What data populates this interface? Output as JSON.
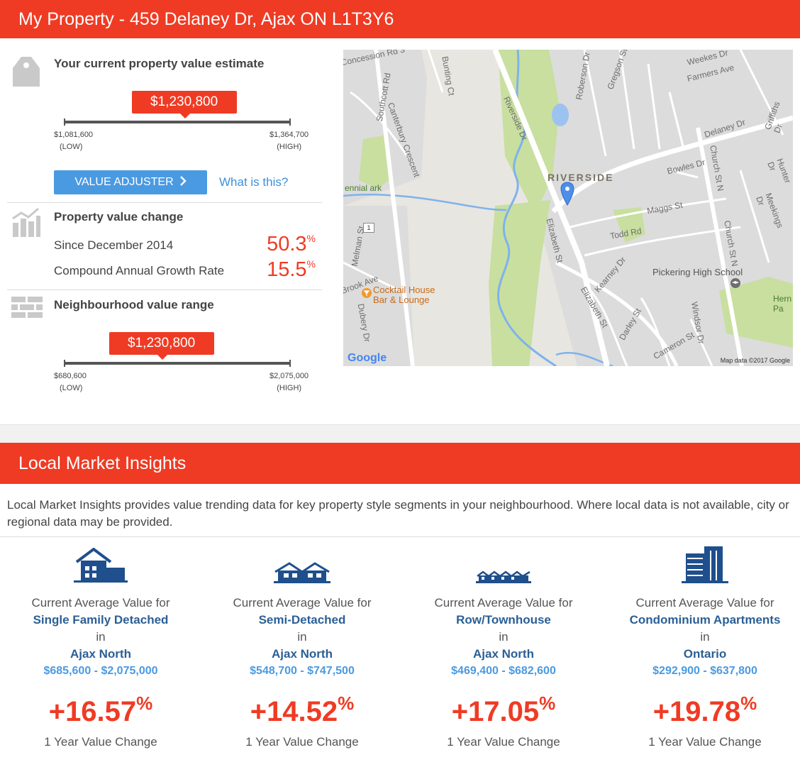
{
  "header": {
    "title": "My Property - 459 Delaney Dr, Ajax ON L1T3Y6"
  },
  "estimate": {
    "title": "Your current property value estimate",
    "value": "$1,230,800",
    "low": "$1,081,600",
    "low_tag": "(LOW)",
    "high": "$1,364,700",
    "high_tag": "(HIGH)",
    "position_fraction": 0.53
  },
  "adjuster": {
    "button_label": "VALUE ADJUSTER",
    "help_link": "What is this?"
  },
  "change": {
    "title": "Property value change",
    "rows": [
      {
        "label": "Since December 2014",
        "value": "50.3",
        "unit": "%"
      },
      {
        "label": "Compound Annual Growth Rate",
        "value": "15.5",
        "unit": "%"
      }
    ]
  },
  "neighbourhood": {
    "title": "Neighbourhood value range",
    "value": "$1,230,800",
    "low": "$680,600",
    "low_tag": "(LOW)",
    "high": "$2,075,000",
    "high_tag": "(HIGH)",
    "position_fraction": 0.43
  },
  "map": {
    "labels": {
      "concession": "Concession Rd 3",
      "southcott": "Southcott Rd",
      "canterbury": "Canterbury Crescent",
      "bunting": "Bunting Ct",
      "riverside_dr": "Riverside Dr",
      "roberson": "Roberson Dr",
      "gregson": "Gregson St",
      "weekes": "Weekes Dr",
      "farmers": "Farmers Ave",
      "griffiths": "Griffiths Dr",
      "delaney": "Delaney Dr",
      "bowles": "Bowles Dr",
      "hunter": "Hunter Dr",
      "meekings": "Meekings Dr",
      "maggs": "Maggs St",
      "todd": "Todd Rd",
      "elizabeth": "Elizabeth St",
      "church": "Church St N",
      "kearney": "Kearney Dr",
      "melman": "Melman St",
      "dubery": "Dubery Dr",
      "brook": "Brook Ave",
      "windsor": "Windsor Dr",
      "cameron": "Cameron St",
      "darley": "Darley St"
    },
    "neighbourhood": "RIVERSIDE",
    "poi": "Cocktail House Bar & Lounge",
    "poi_line2": "Bar & Lounge",
    "poi_line1": "Cocktail House",
    "school": "Pickering High School",
    "park_left": "ennial ark",
    "park_right": "Hern Pa",
    "route": "1",
    "google": "Google",
    "credit": "Map data ©2017 Google"
  },
  "insights": {
    "title": "Local Market Insights",
    "intro": "Local Market Insights provides value trending data for key property style segments in your neighbourhood. Where local data is not available, city or regional data may be provided.",
    "caption": "Current Average Value for",
    "in_word": "in",
    "change_label": "1 Year Value Change",
    "segments": [
      {
        "segment": "Single Family Detached",
        "area": "Ajax North",
        "range": "$685,600 - $2,075,000",
        "change": "+16.57",
        "unit": "%",
        "icon": "detached-house-icon"
      },
      {
        "segment": "Semi-Detached",
        "area": "Ajax North",
        "range": "$548,700 - $747,500",
        "change": "+14.52",
        "unit": "%",
        "icon": "semi-detached-icon"
      },
      {
        "segment": "Row/Townhouse",
        "area": "Ajax North",
        "range": "$469,400 - $682,600",
        "change": "+17.05",
        "unit": "%",
        "icon": "townhouse-icon"
      },
      {
        "segment": "Condominium Apartments",
        "area": "Ontario",
        "range": "$292,900 - $637,800",
        "change": "+19.78",
        "unit": "%",
        "icon": "condo-icon"
      }
    ]
  },
  "colors": {
    "brand_red": "#ef3b24",
    "link_blue": "#3d8fd9",
    "navy": "#2b5f95"
  }
}
